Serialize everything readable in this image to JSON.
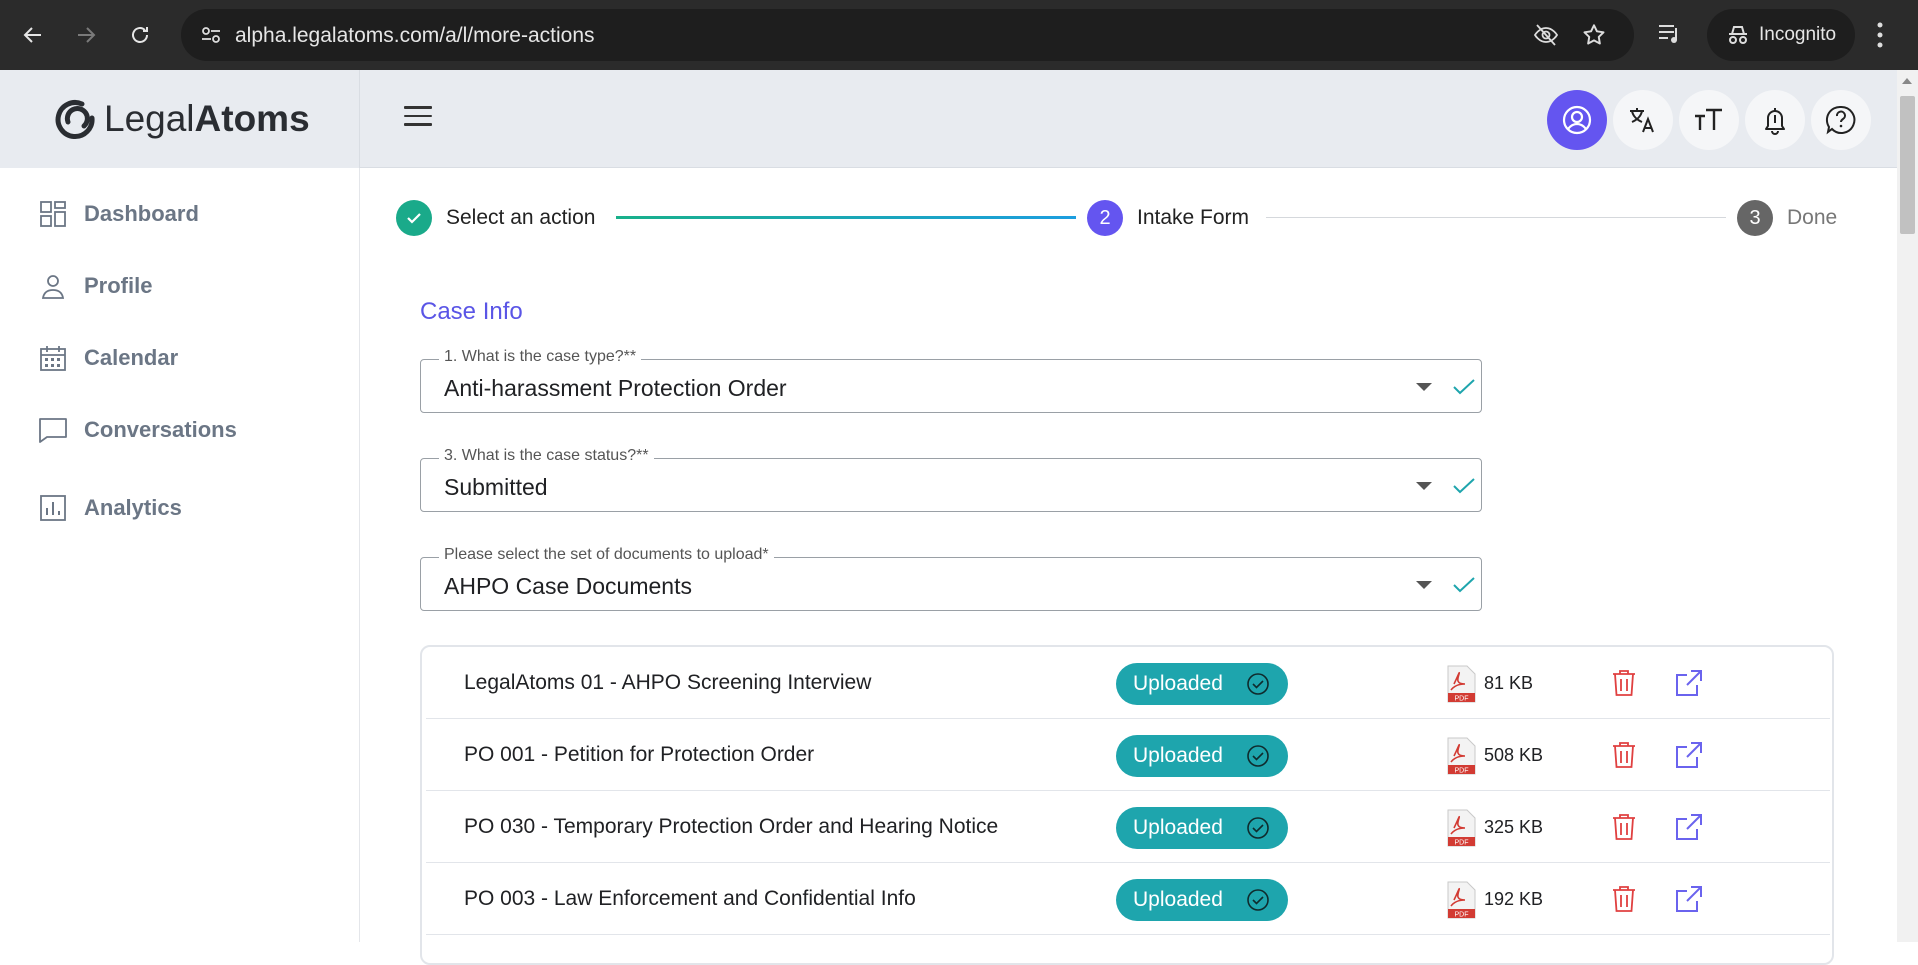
{
  "browser": {
    "url": "alpha.legalatoms.com/a/l/more-actions",
    "profile_label": "Incognito"
  },
  "brand": {
    "name_regular": "Legal",
    "name_bold": "Atoms",
    "primary_color": "#6455f0",
    "teal_color": "#1ea5ad"
  },
  "sidebar": {
    "items": [
      {
        "label": "Dashboard",
        "icon": "dashboard-grid-icon"
      },
      {
        "label": "Profile",
        "icon": "person-icon"
      },
      {
        "label": "Calendar",
        "icon": "calendar-icon"
      },
      {
        "label": "Conversations",
        "icon": "chat-bubble-icon"
      },
      {
        "label": "Analytics",
        "icon": "bar-chart-icon"
      }
    ]
  },
  "header_icons": [
    "account-circle-icon",
    "translate-icon",
    "text-size-icon",
    "bell-icon",
    "help-icon"
  ],
  "stepper": {
    "steps": [
      {
        "label": "Select an action",
        "state": "complete"
      },
      {
        "number": "2",
        "label": "Intake Form",
        "state": "active"
      },
      {
        "number": "3",
        "label": "Done",
        "state": "pending"
      }
    ]
  },
  "form": {
    "section_title": "Case Info",
    "fields": [
      {
        "label": "1. What is the case type?**",
        "value": "Anti-harassment Protection Order"
      },
      {
        "label": "3. What is the case status?**",
        "value": "Submitted"
      },
      {
        "label": "Please select the set of documents to upload*",
        "value": "AHPO Case Documents"
      }
    ]
  },
  "documents": [
    {
      "name": "LegalAtoms 01 - AHPO Screening Interview",
      "status": "Uploaded",
      "size": "81 KB"
    },
    {
      "name": "PO 001 - Petition for Protection Order",
      "status": "Uploaded",
      "size": "508 KB"
    },
    {
      "name": "PO 030 - Temporary Protection Order and Hearing Notice",
      "status": "Uploaded",
      "size": "325 KB"
    },
    {
      "name": "PO 003 - Law Enforcement and Confidential Info",
      "status": "Uploaded",
      "size": "192 KB"
    }
  ],
  "pdf_label": "PDF"
}
